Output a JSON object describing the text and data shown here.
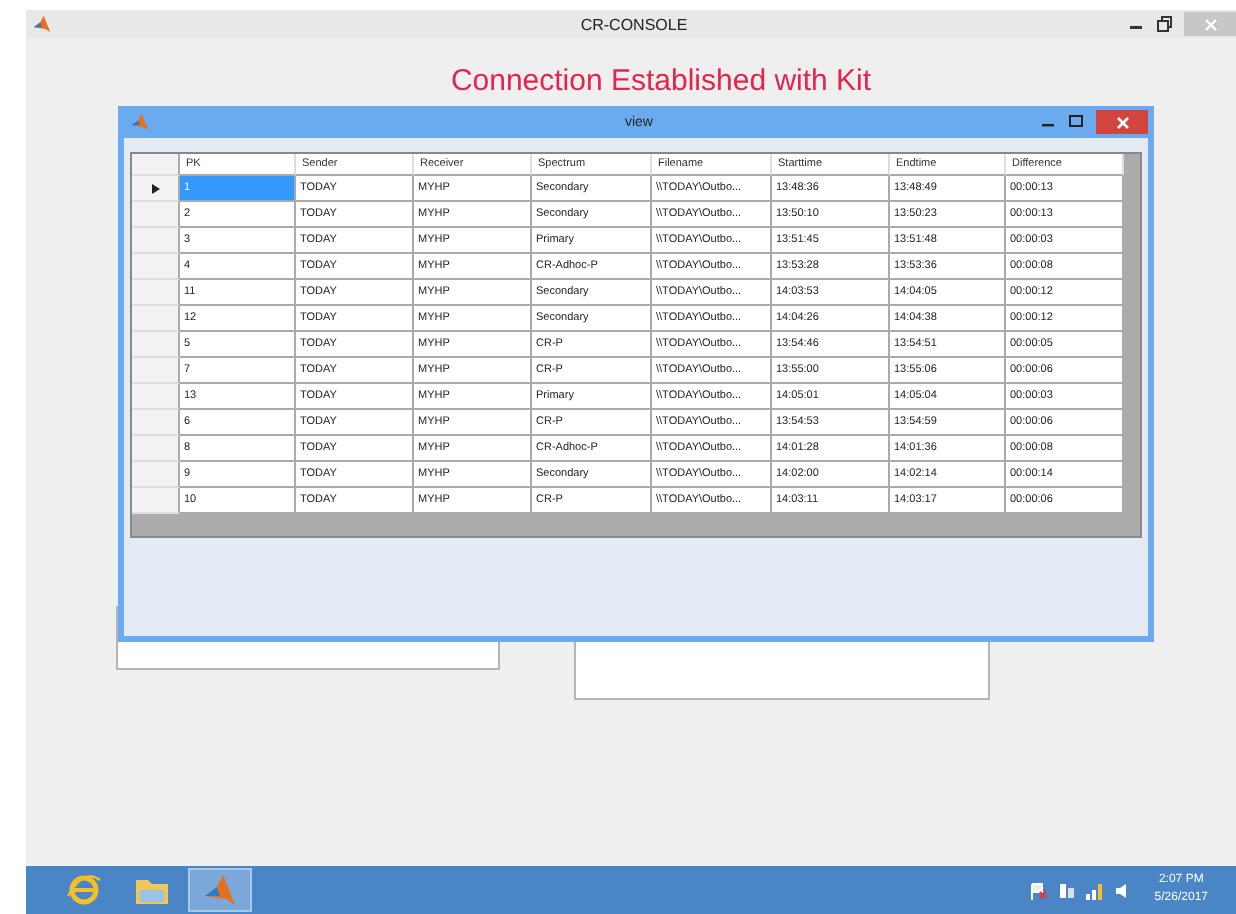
{
  "window": {
    "title": "CR-CONSOLE"
  },
  "heading": "Connection Established with Kit",
  "view": {
    "title": "view",
    "columns": [
      "PK",
      "Sender",
      "Receiver",
      "Spectrum",
      "Filename",
      "Starttime",
      "Endtime",
      "Difference"
    ],
    "rows": [
      {
        "selected": true,
        "cells": [
          "1",
          "TODAY",
          "MYHP",
          "Secondary",
          "\\\\TODAY\\Outbo...",
          "13:48:36",
          "13:48:49",
          "00:00:13"
        ]
      },
      {
        "selected": false,
        "cells": [
          "2",
          "TODAY",
          "MYHP",
          "Secondary",
          "\\\\TODAY\\Outbo...",
          "13:50:10",
          "13:50:23",
          "00:00:13"
        ]
      },
      {
        "selected": false,
        "cells": [
          "3",
          "TODAY",
          "MYHP",
          "Primary",
          "\\\\TODAY\\Outbo...",
          "13:51:45",
          "13:51:48",
          "00:00:03"
        ]
      },
      {
        "selected": false,
        "cells": [
          "4",
          "TODAY",
          "MYHP",
          "CR-Adhoc-P",
          "\\\\TODAY\\Outbo...",
          "13:53:28",
          "13:53:36",
          "00:00:08"
        ]
      },
      {
        "selected": false,
        "cells": [
          "11",
          "TODAY",
          "MYHP",
          "Secondary",
          "\\\\TODAY\\Outbo...",
          "14:03:53",
          "14:04:05",
          "00:00:12"
        ]
      },
      {
        "selected": false,
        "cells": [
          "12",
          "TODAY",
          "MYHP",
          "Secondary",
          "\\\\TODAY\\Outbo...",
          "14:04:26",
          "14:04:38",
          "00:00:12"
        ]
      },
      {
        "selected": false,
        "cells": [
          "5",
          "TODAY",
          "MYHP",
          "CR-P",
          "\\\\TODAY\\Outbo...",
          "13:54:46",
          "13:54:51",
          "00:00:05"
        ]
      },
      {
        "selected": false,
        "cells": [
          "7",
          "TODAY",
          "MYHP",
          "CR-P",
          "\\\\TODAY\\Outbo...",
          "13:55:00",
          "13:55:06",
          "00:00:06"
        ]
      },
      {
        "selected": false,
        "cells": [
          "13",
          "TODAY",
          "MYHP",
          "Primary",
          "\\\\TODAY\\Outbo...",
          "14:05:01",
          "14:05:04",
          "00:00:03"
        ]
      },
      {
        "selected": false,
        "cells": [
          "6",
          "TODAY",
          "MYHP",
          "CR-P",
          "\\\\TODAY\\Outbo...",
          "13:54:53",
          "13:54:59",
          "00:00:06"
        ]
      },
      {
        "selected": false,
        "cells": [
          "8",
          "TODAY",
          "MYHP",
          "CR-Adhoc-P",
          "\\\\TODAY\\Outbo...",
          "14:01:28",
          "14:01:36",
          "00:00:08"
        ]
      },
      {
        "selected": false,
        "cells": [
          "9",
          "TODAY",
          "MYHP",
          "Secondary",
          "\\\\TODAY\\Outbo...",
          "14:02:00",
          "14:02:14",
          "00:00:14"
        ]
      },
      {
        "selected": false,
        "cells": [
          "10",
          "TODAY",
          "MYHP",
          "CR-P",
          "\\\\TODAY\\Outbo...",
          "14:03:11",
          "14:03:17",
          "00:00:06"
        ]
      }
    ]
  },
  "taskbar": {
    "apps": [
      {
        "kind": "browser",
        "selected": false
      },
      {
        "kind": "folder",
        "selected": false
      },
      {
        "kind": "matlab",
        "selected": true
      }
    ],
    "time": "2:07 PM",
    "date": "5/26/2017"
  }
}
